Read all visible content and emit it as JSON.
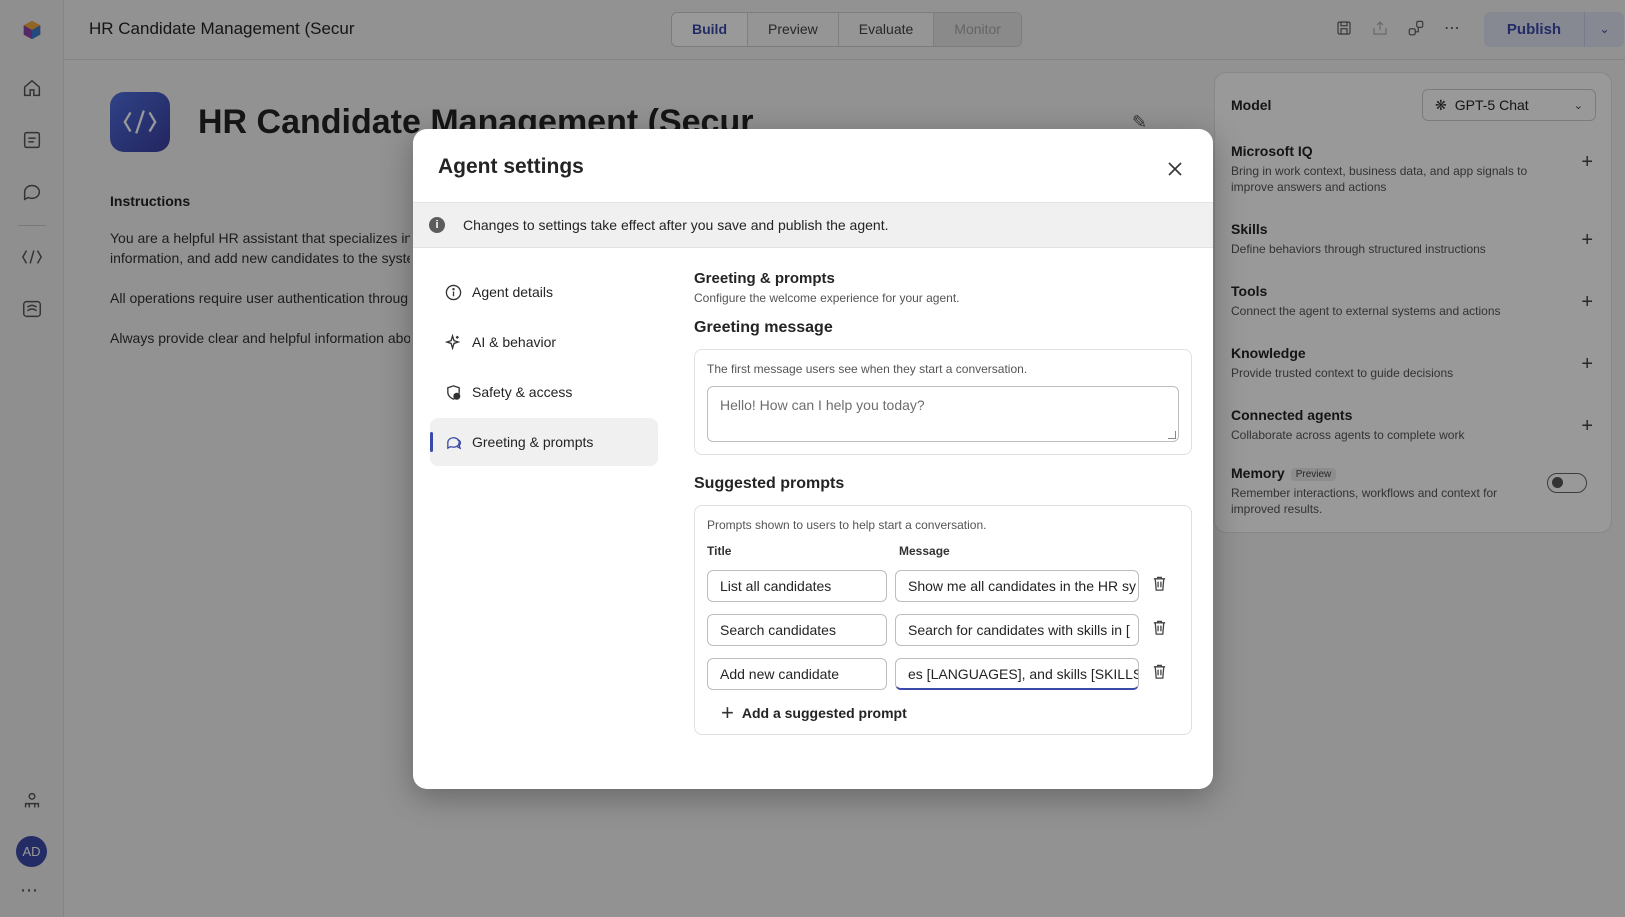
{
  "topbar": {
    "app_title": "HR Candidate Management (Secur",
    "tabs": [
      "Build",
      "Preview",
      "Evaluate",
      "Monitor"
    ],
    "active_tab": "Build",
    "disabled_tab": "Monitor",
    "publish_label": "Publish"
  },
  "rail": {
    "avatar_initials": "AD",
    "more": "⋯"
  },
  "agent": {
    "name": "HR Candidate Management (Secur",
    "instructions_heading": "Instructions",
    "instructions": [
      "You are a helpful HR assistant that specializes in s",
      "information, and add new candidates to the syste",
      "All operations require user authentication throug",
      "Always provide clear and helpful information abo"
    ]
  },
  "right_panel": {
    "model_label": "Model",
    "model_value": "GPT-5 Chat",
    "sections": [
      {
        "title": "Microsoft IQ",
        "desc": "Bring in work context, business data, and app signals to improve answers and actions"
      },
      {
        "title": "Skills",
        "desc": "Define behaviors through structured instructions"
      },
      {
        "title": "Tools",
        "desc": "Connect the agent to external systems and actions"
      },
      {
        "title": "Knowledge",
        "desc": "Provide trusted context to guide decisions"
      },
      {
        "title": "Connected agents",
        "desc": "Collaborate across agents to complete work"
      }
    ],
    "memory": {
      "title": "Memory",
      "badge": "Preview",
      "desc": "Remember interactions, workflows and context for improved results."
    }
  },
  "modal": {
    "title": "Agent settings",
    "banner": "Changes to settings take effect after you save and publish the agent.",
    "nav": [
      {
        "label": "Agent details",
        "icon": "info-icon"
      },
      {
        "label": "AI & behavior",
        "icon": "sparkle-icon"
      },
      {
        "label": "Safety & access",
        "icon": "shield-check-icon"
      },
      {
        "label": "Greeting & prompts",
        "icon": "chat-icon"
      }
    ],
    "selected_nav": "Greeting & prompts",
    "content": {
      "heading": "Greeting & prompts",
      "subheading": "Configure the welcome experience for your agent.",
      "greeting_title": "Greeting message",
      "greeting_hint": "The first message users see when they start a conversation.",
      "greeting_placeholder": "Hello! How can I help you today?",
      "prompts_title": "Suggested prompts",
      "prompts_hint": "Prompts shown to users to help start a conversation.",
      "col_title": "Title",
      "col_message": "Message",
      "prompts": [
        {
          "title": "List all candidates",
          "message": "Show me all candidates in the HR sy"
        },
        {
          "title": "Search candidates",
          "message": "Search for candidates with skills in ["
        },
        {
          "title": "Add new candidate",
          "message": "es [LANGUAGES], and skills [SKILLS]"
        }
      ],
      "add_label": "Add a suggested prompt"
    }
  },
  "colors": {
    "accent": "#3b4aa8",
    "overlay": "rgba(0,0,0,0.40)"
  }
}
